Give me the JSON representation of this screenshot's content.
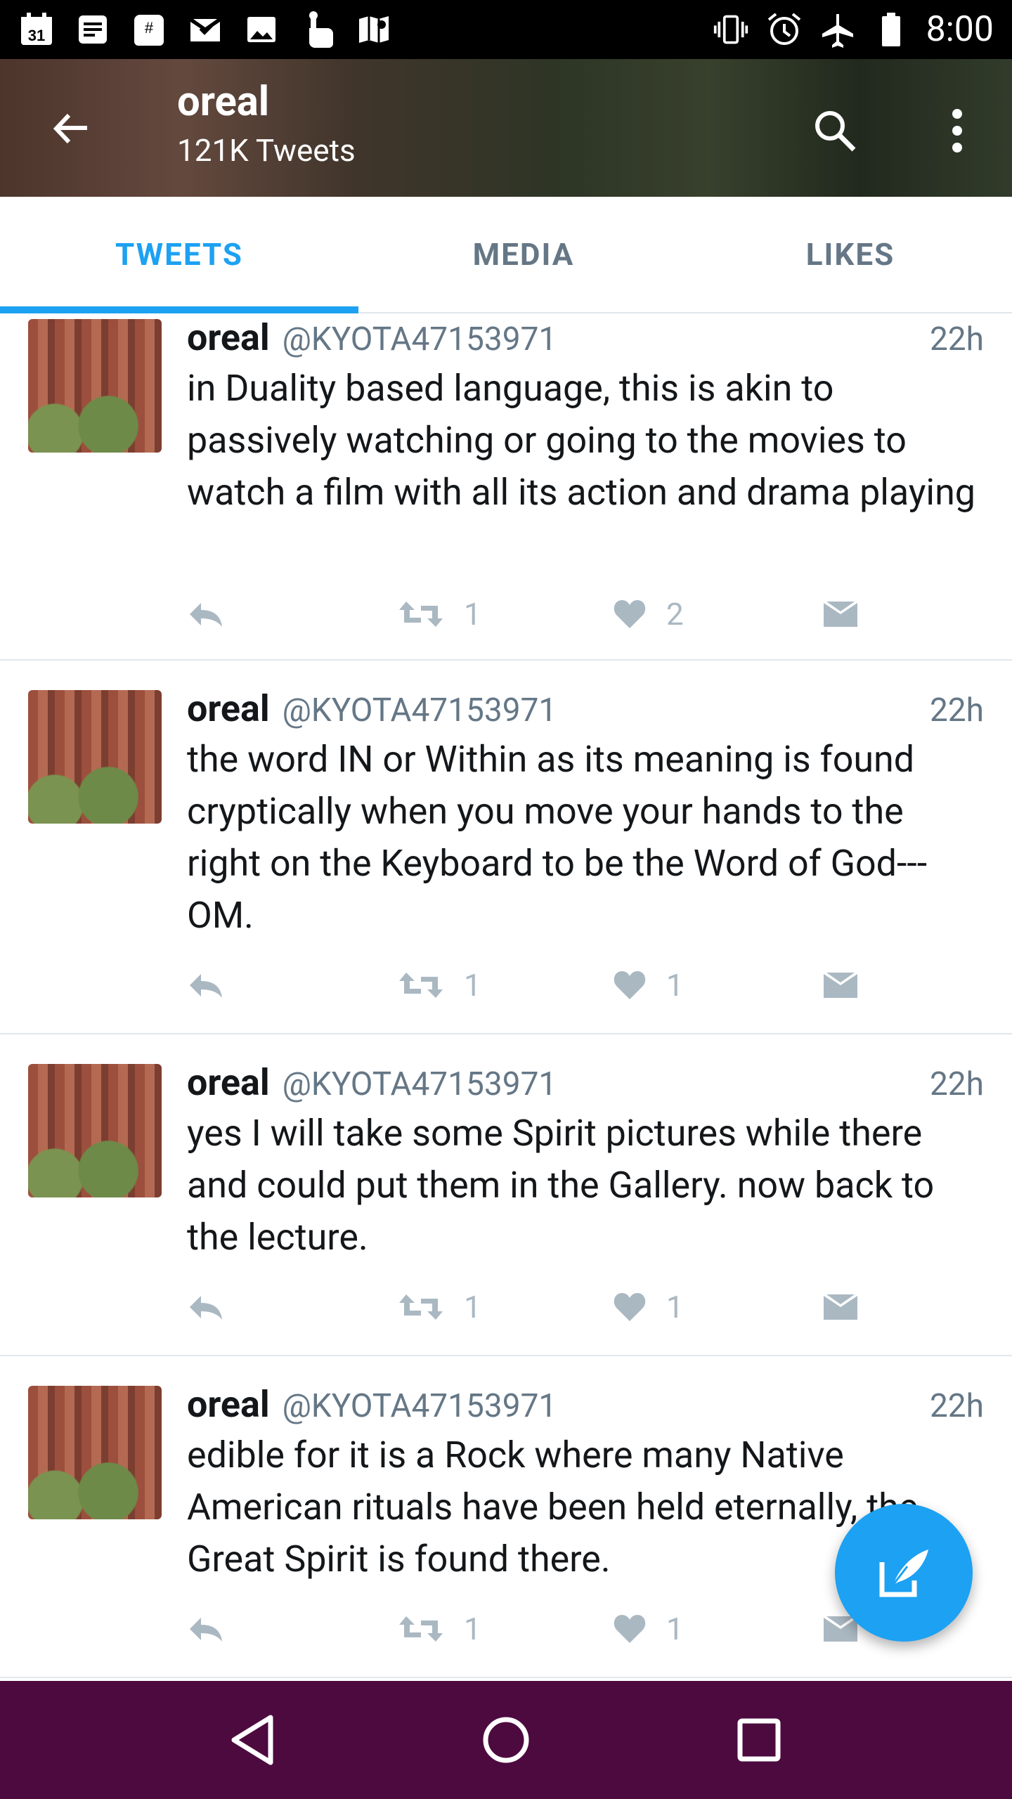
{
  "status_bar": {
    "time": "8:00",
    "left_icons": [
      "calendar-icon",
      "notes-icon",
      "inbox-icon",
      "mail-done-icon",
      "photo-icon",
      "touch-icon",
      "maps-icon"
    ],
    "calendar_date": "31",
    "right_icons": [
      "vibrate-icon",
      "alarm-icon",
      "airplane-icon",
      "battery-icon"
    ]
  },
  "header": {
    "title": "oreal",
    "subtitle": "121K Tweets"
  },
  "tabs": [
    {
      "label": "TWEETS",
      "active": true
    },
    {
      "label": "MEDIA",
      "active": false
    },
    {
      "label": "LIKES",
      "active": false
    }
  ],
  "tweets": [
    {
      "name": "oreal",
      "handle": "@KYOTA47153971",
      "time": "22h",
      "text": "in Duality based language, this is akin to passively watching  or going to the movies to watch a film with all its action and drama playing",
      "retweets": "1",
      "likes": "2"
    },
    {
      "name": "oreal",
      "handle": "@KYOTA47153971",
      "time": "22h",
      "text": "the word IN or Within as its meaning is found cryptically when you move your hands to the right on the Keyboard to be the Word of God---OM.",
      "retweets": "1",
      "likes": "1"
    },
    {
      "name": "oreal",
      "handle": "@KYOTA47153971",
      "time": "22h",
      "text": "yes I will take some Spirit pictures while there and could put them in the Gallery.  now back to the lecture.",
      "retweets": "1",
      "likes": "1"
    },
    {
      "name": "oreal",
      "handle": "@KYOTA47153971",
      "time": "22h",
      "text": "edible for it is a Rock where many Native American rituals have been held eternally, the Great Spirit is found there.",
      "retweets": "1",
      "likes": "1"
    }
  ],
  "colors": {
    "accent": "#1da1f2",
    "nav_bar": "#4d0a3f",
    "secondary_text": "#657786",
    "action_icon": "#aab8c2"
  }
}
